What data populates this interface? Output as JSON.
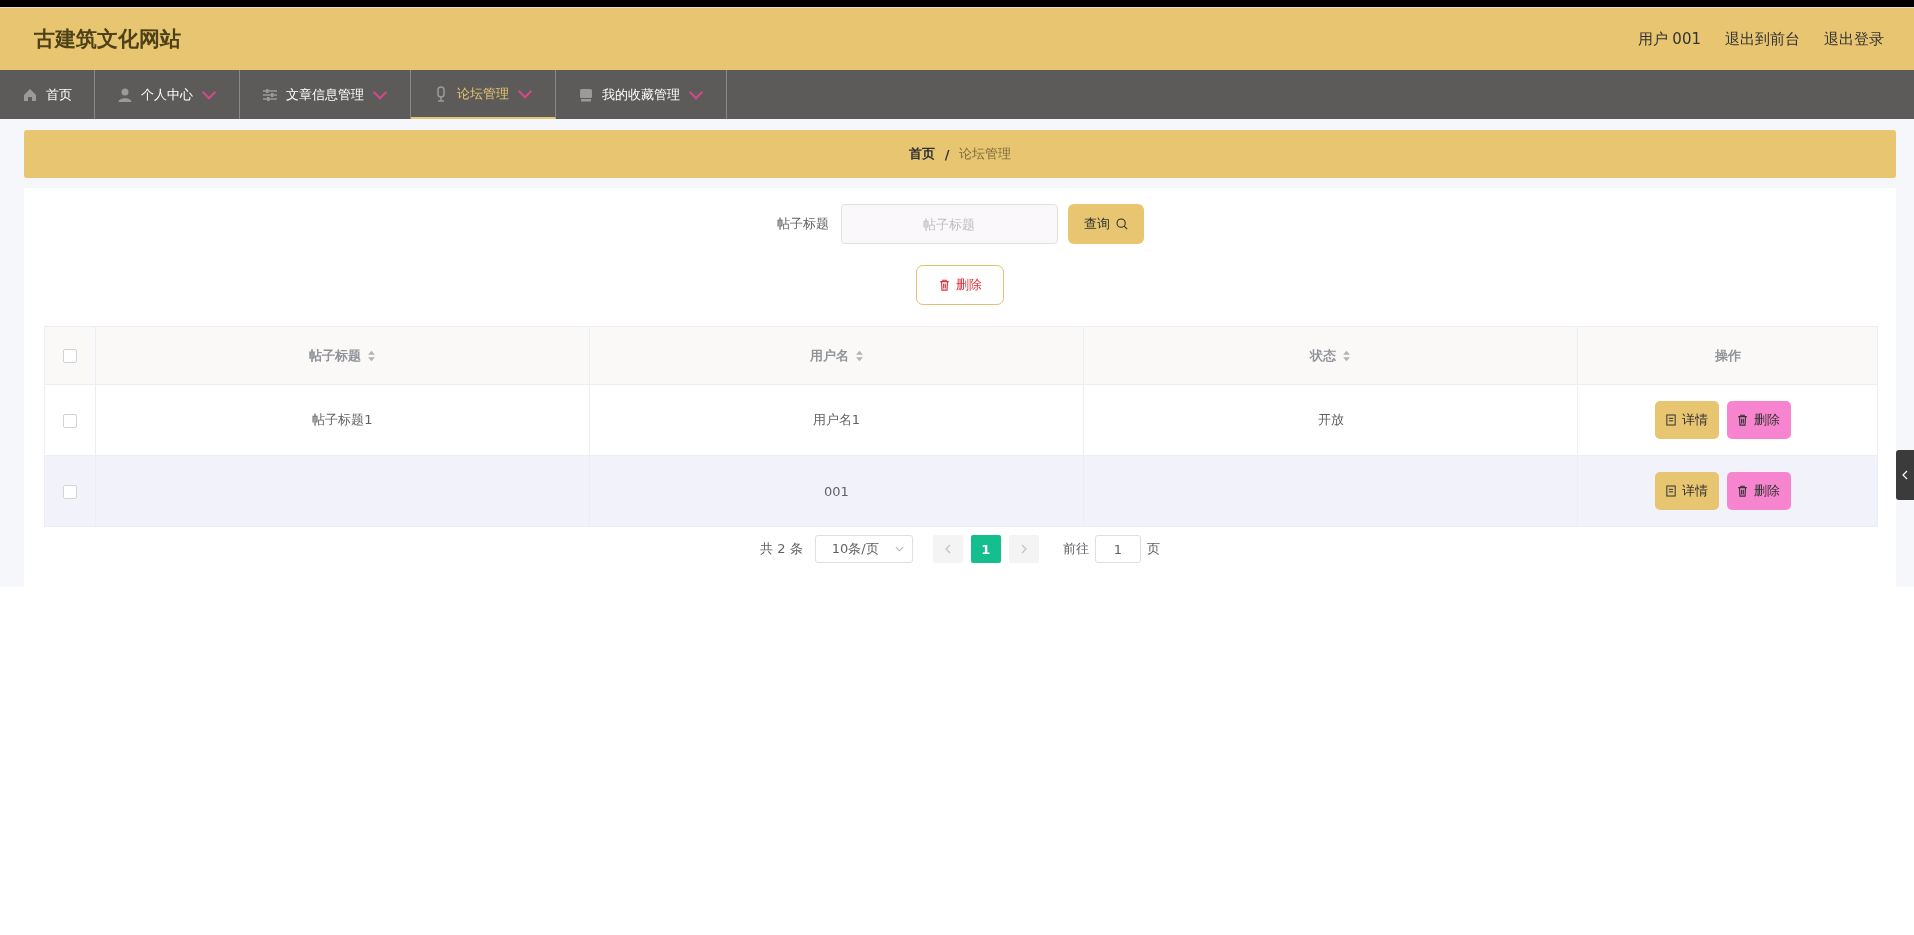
{
  "header": {
    "title": "古建筑文化网站",
    "links": [
      "用户 001",
      "退出到前台",
      "退出登录"
    ]
  },
  "nav": [
    {
      "label": "首页",
      "dropdown": false,
      "selected": false
    },
    {
      "label": "个人中心",
      "dropdown": true,
      "selected": false
    },
    {
      "label": "文章信息管理",
      "dropdown": true,
      "selected": false
    },
    {
      "label": "论坛管理",
      "dropdown": true,
      "selected": true
    },
    {
      "label": "我的收藏管理",
      "dropdown": true,
      "selected": false
    }
  ],
  "breadcrumb": [
    {
      "label": "首页",
      "current": false
    },
    {
      "label": "论坛管理",
      "current": true
    }
  ],
  "breadcrumb_separator": "/",
  "search": {
    "label": "帖子标题",
    "placeholder": "帖子标题",
    "button": "查询"
  },
  "bulk_delete_button": "删除",
  "table": {
    "select_all_checked": false,
    "columns": [
      {
        "label": "帖子标题",
        "sortable": true
      },
      {
        "label": "用户名",
        "sortable": true
      },
      {
        "label": "状态",
        "sortable": true
      },
      {
        "label": "操作",
        "sortable": false
      }
    ],
    "rows": [
      {
        "checked": false,
        "hovered": false,
        "cells": [
          "帖子标题1",
          "用户名1",
          "开放"
        ],
        "actions": [
          "详情",
          "删除"
        ]
      },
      {
        "checked": false,
        "hovered": true,
        "cells": [
          "",
          "001",
          ""
        ],
        "actions": [
          "详情",
          "删除"
        ]
      }
    ]
  },
  "pagination": {
    "total": "共 2 条",
    "page_size": "10条/页",
    "pages": [
      {
        "label": "1",
        "selected": true
      }
    ],
    "goto_label": "前往",
    "goto_value": "1",
    "goto_suffix": "页"
  }
}
